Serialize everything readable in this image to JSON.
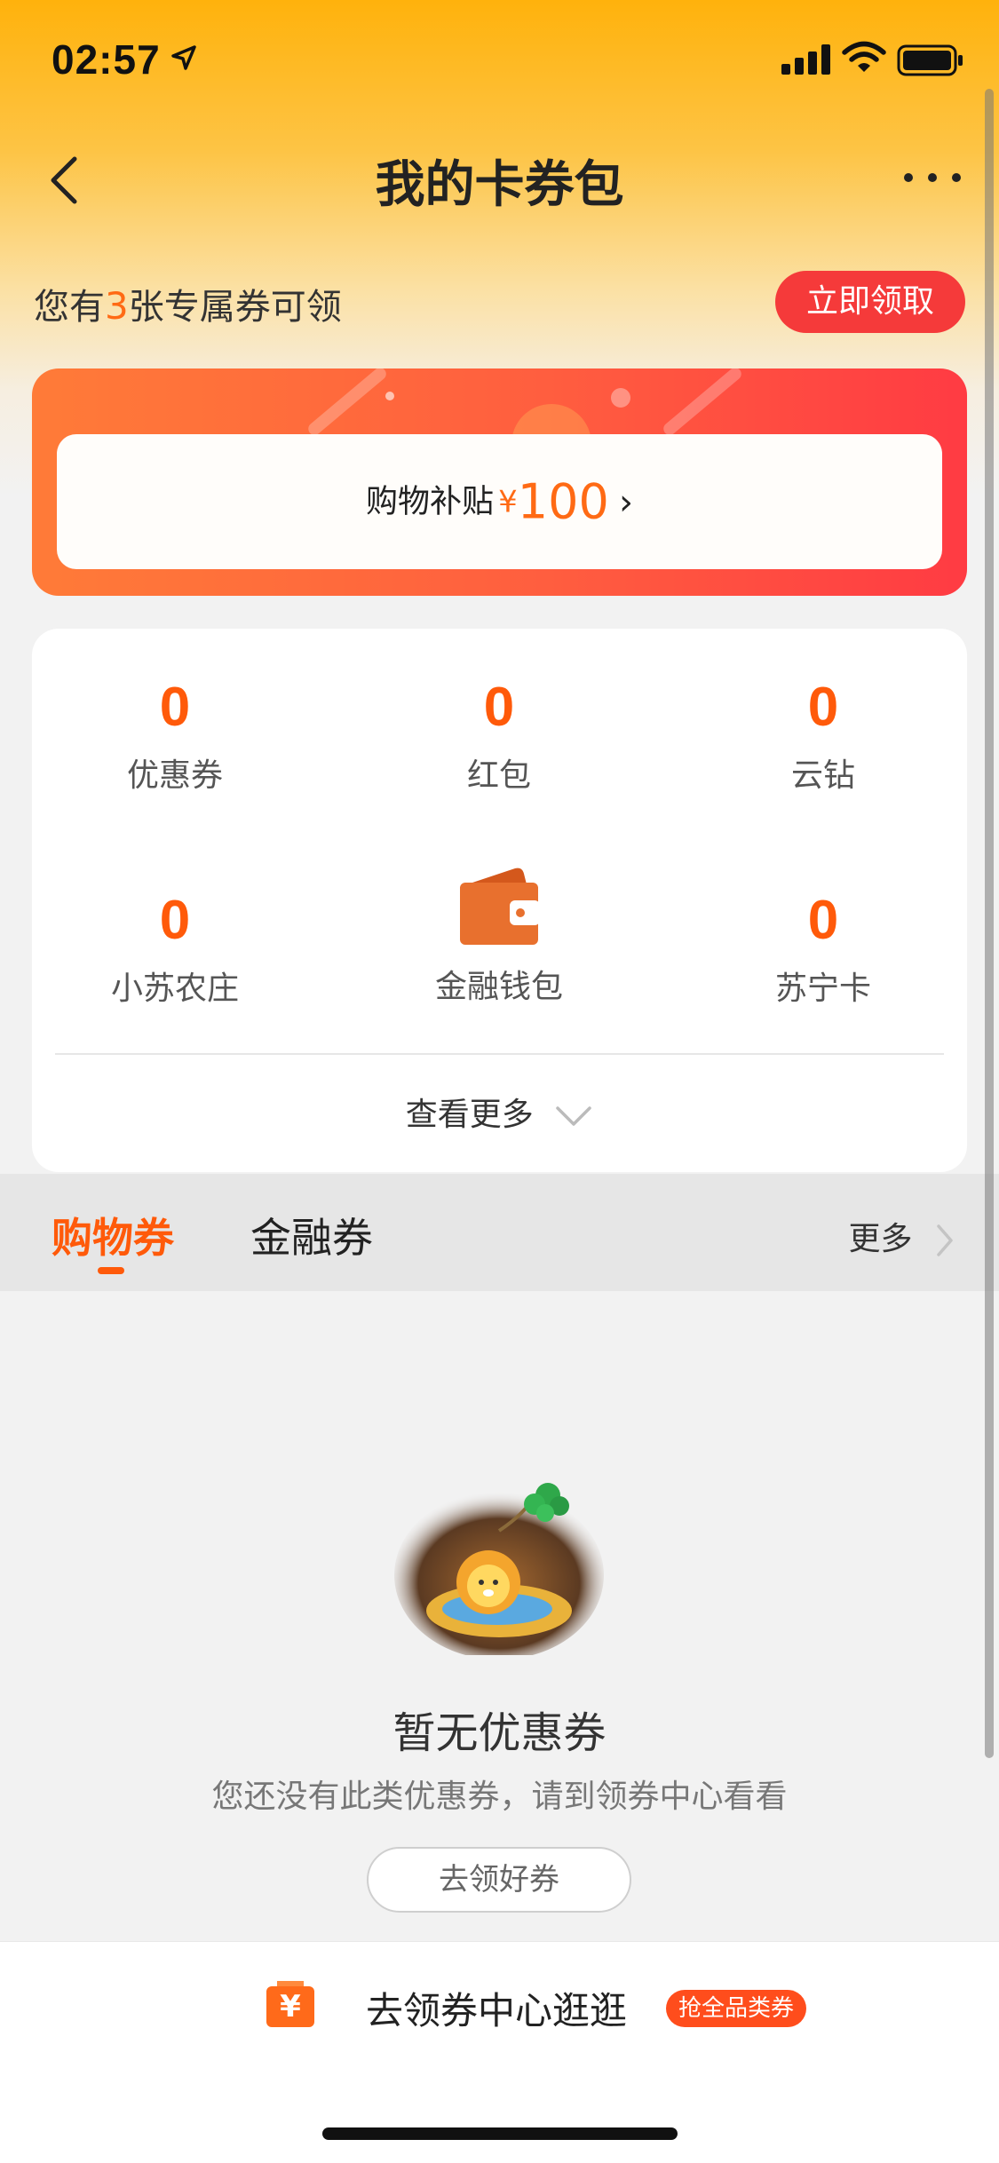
{
  "status_bar": {
    "time": "02:57"
  },
  "nav": {
    "title": "我的卡券包"
  },
  "banner": {
    "text_before": "您有",
    "count": "3",
    "text_after": "张专属券可领",
    "claim_button": "立即领取"
  },
  "subsidy": {
    "label": "购物补贴",
    "currency": "¥",
    "amount": "100",
    "chevron": "›"
  },
  "stats": [
    {
      "value": "0",
      "label": "优惠券"
    },
    {
      "value": "0",
      "label": "红包"
    },
    {
      "value": "0",
      "label": "云钻"
    },
    {
      "value": "0",
      "label": "小苏农庄"
    },
    {
      "icon": "wallet-icon",
      "label": "金融钱包"
    },
    {
      "value": "0",
      "label": "苏宁卡"
    }
  ],
  "see_more": "查看更多",
  "tabs": {
    "shopping": "购物券",
    "finance": "金融券",
    "more": "更多"
  },
  "empty": {
    "title": "暂无优惠券",
    "description": "您还没有此类优惠券，请到领券中心看看",
    "button": "去领好券"
  },
  "bottom": {
    "text": "去领券中心逛逛",
    "badge": "抢全品类券"
  },
  "colors": {
    "accent_orange": "#ff5a0a",
    "claim_red": "#f53a3a",
    "header_yellow": "#ffb20c"
  }
}
